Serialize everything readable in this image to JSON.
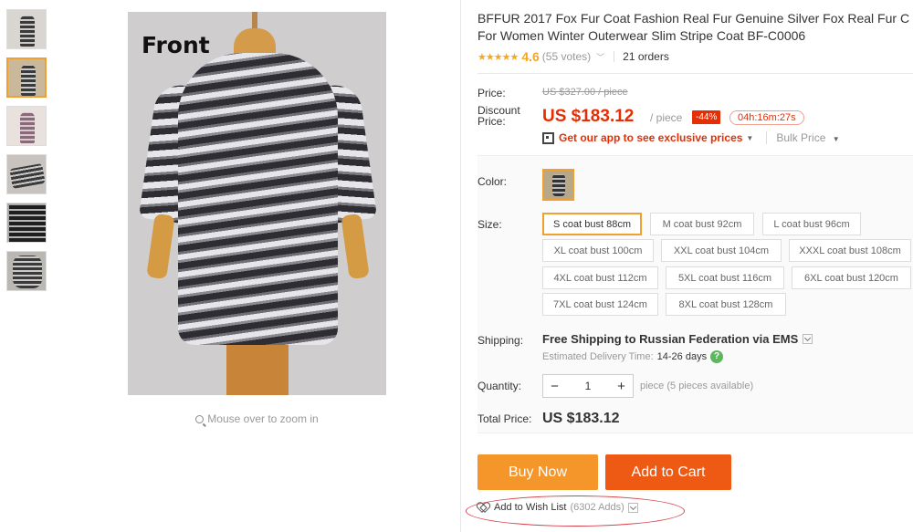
{
  "gallery": {
    "main_image_label": "Front",
    "zoom_hint": "Mouse over to zoom in",
    "thumbnail_count": 6
  },
  "product": {
    "title_line1": "BFFUR 2017 Fox Fur Coat Fashion Real Fur Genuine Silver Fox Real Fur C",
    "title_line2": "For Women Winter Outerwear Slim Stripe Coat BF-C0006",
    "rating": "4.6",
    "votes": "(55 votes)",
    "orders": "21 orders"
  },
  "pricing": {
    "price_label": "Price:",
    "original_price": "US $327.00 / piece",
    "discount_label_1": "Discount",
    "discount_label_2": "Price:",
    "discount_price": "US $183.12",
    "per_unit": "/ piece",
    "discount_badge": "-44%",
    "countdown": "04h:16m:27s",
    "app_promo": "Get our app to see exclusive prices",
    "bulk_price": "Bulk Price"
  },
  "options": {
    "color_label": "Color:",
    "size_label": "Size:",
    "sizes": [
      "S coat bust 88cm",
      "M coat bust 92cm",
      "L coat bust 96cm",
      "XL coat bust 100cm",
      "XXL coat bust 104cm",
      "XXXL coat bust 108cm",
      "4XL coat bust 112cm",
      "5XL coat bust 116cm",
      "6XL coat bust 120cm",
      "7XL coat bust 124cm",
      "8XL coat bust 128cm"
    ],
    "selected_size": "S coat bust 88cm"
  },
  "shipping": {
    "label": "Shipping:",
    "value": "Free Shipping to Russian Federation via EMS",
    "delivery_label": "Estimated Delivery Time:",
    "delivery_days": "14-26 days"
  },
  "quantity": {
    "label": "Quantity:",
    "minus": "−",
    "value": "1",
    "plus": "+",
    "note": "piece (5 pieces available)"
  },
  "total": {
    "label": "Total Price:",
    "value": "US $183.12"
  },
  "actions": {
    "buy_now": "Buy Now",
    "add_to_cart": "Add to Cart",
    "wishlist": "Add to Wish List",
    "wishlist_count": "(6302 Adds)"
  },
  "colors": {
    "accent_orange": "#f5962a",
    "cart_orange": "#ee5a13",
    "price_red": "#e62e04",
    "star_yellow": "#f5a623",
    "selected_border": "#f0a030"
  }
}
